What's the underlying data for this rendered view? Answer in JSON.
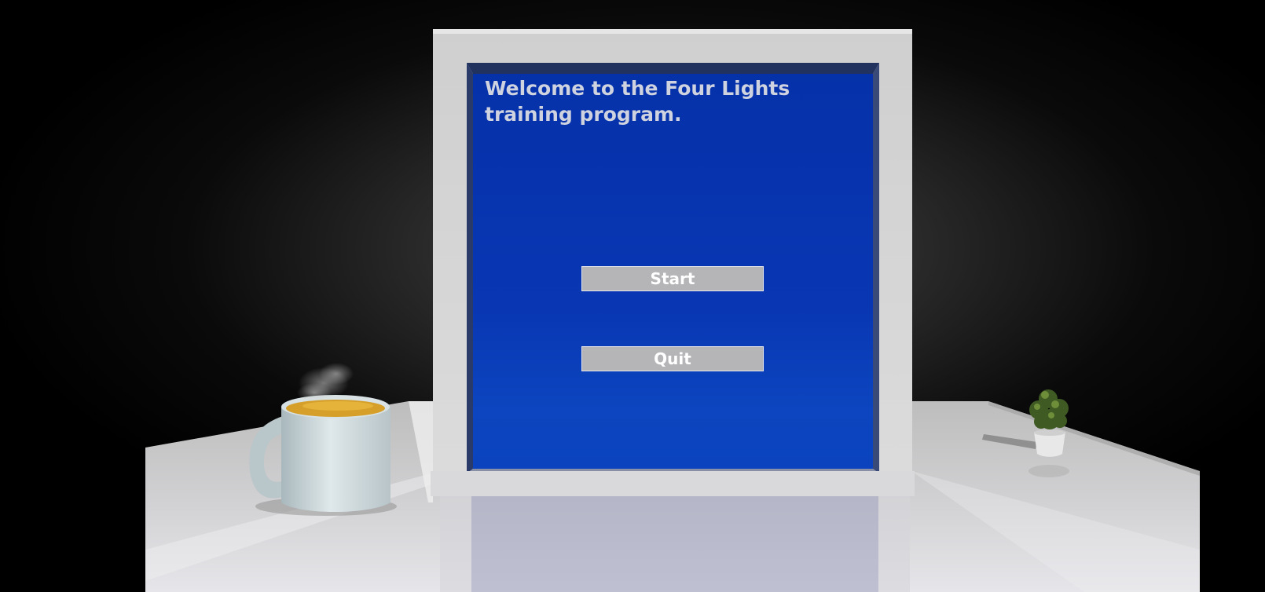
{
  "screen": {
    "title": "Welcome to the Four Lights training program.",
    "start_label": "Start",
    "quit_label": "Quit"
  },
  "colors": {
    "screen_blue": "#0531a9",
    "button_gray": "#b5b5b8",
    "button_text": "#ffffff",
    "title_text": "#cfd3e0",
    "frame_white": "#d9d9d9"
  }
}
